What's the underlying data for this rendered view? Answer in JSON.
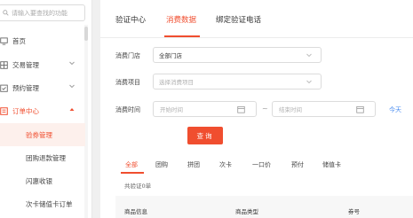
{
  "sidebar": {
    "search_placeholder": "请输入要查找的功能",
    "items": [
      {
        "label": "首页",
        "icon": "monitor-icon"
      },
      {
        "label": "交易管理",
        "icon": "grid-icon"
      },
      {
        "label": "预约管理",
        "icon": "calendar-check-icon"
      },
      {
        "label": "订单中心",
        "icon": "order-list-icon"
      }
    ],
    "sub_items": [
      {
        "label": "验券管理"
      },
      {
        "label": "团购退款管理"
      },
      {
        "label": "闪惠收银"
      },
      {
        "label": "次卡储值卡订单"
      }
    ]
  },
  "tabs": [
    {
      "label": "验证中心"
    },
    {
      "label": "消费数据"
    },
    {
      "label": "绑定验证电话"
    }
  ],
  "filters": {
    "store_label": "消费门店",
    "store_value": "全部门店",
    "item_label": "消费项目",
    "item_placeholder": "选择消费项目",
    "time_label": "消费时间",
    "start_placeholder": "开始时间",
    "end_placeholder": "结束时间",
    "separator": "~",
    "today": "今天",
    "query_button": "查询"
  },
  "type_tabs": [
    {
      "label": "全部"
    },
    {
      "label": "团购"
    },
    {
      "label": "拼团"
    },
    {
      "label": "次卡"
    },
    {
      "label": "一口价"
    },
    {
      "label": "预付"
    },
    {
      "label": "储值卡"
    }
  ],
  "total_text": "共验证0单",
  "table_headers": [
    {
      "label": "商品信息"
    },
    {
      "label": "商品类型"
    },
    {
      "label": "券号"
    }
  ],
  "colors": {
    "accent": "#f04e2f",
    "link": "#4a8cf0"
  }
}
